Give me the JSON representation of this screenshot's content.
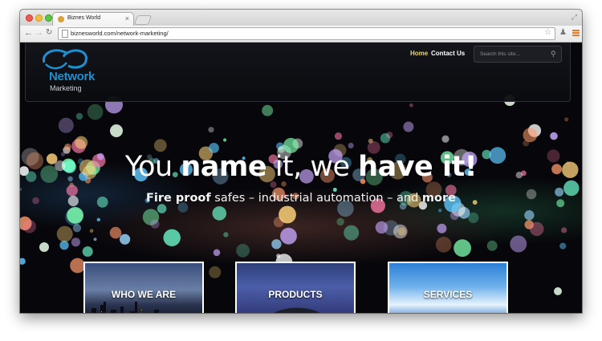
{
  "browser": {
    "tab_title": "Biznes World",
    "tab_close": "×",
    "url": "biznesworld.com/network-marketing/",
    "icons": {
      "back": "arrow-left-icon",
      "forward": "arrow-right-icon",
      "reload": "reload-icon",
      "bookmark": "star-icon",
      "extension": "extension-icon",
      "menu": "hamburger-icon"
    }
  },
  "header": {
    "logo_title": "Network",
    "logo_subtitle": "Marketing",
    "nav": [
      {
        "label": "Home",
        "active": true
      },
      {
        "label": "Contact Us",
        "active": false
      }
    ],
    "search_placeholder": "Search this site..."
  },
  "hero": {
    "title_parts": [
      "You ",
      "name",
      " it, we ",
      "have it!"
    ],
    "subtitle_parts": [
      "Fire proof",
      " safes – industrial automation – and ",
      "more"
    ]
  },
  "tiles": [
    {
      "label": "WHO WE ARE"
    },
    {
      "label": "PRODUCTS"
    },
    {
      "label": "SERVICES"
    }
  ],
  "colors": {
    "nav_active": "#f0d562",
    "logo_blue": "#1f8fd0",
    "page_bg": "#07070b"
  }
}
